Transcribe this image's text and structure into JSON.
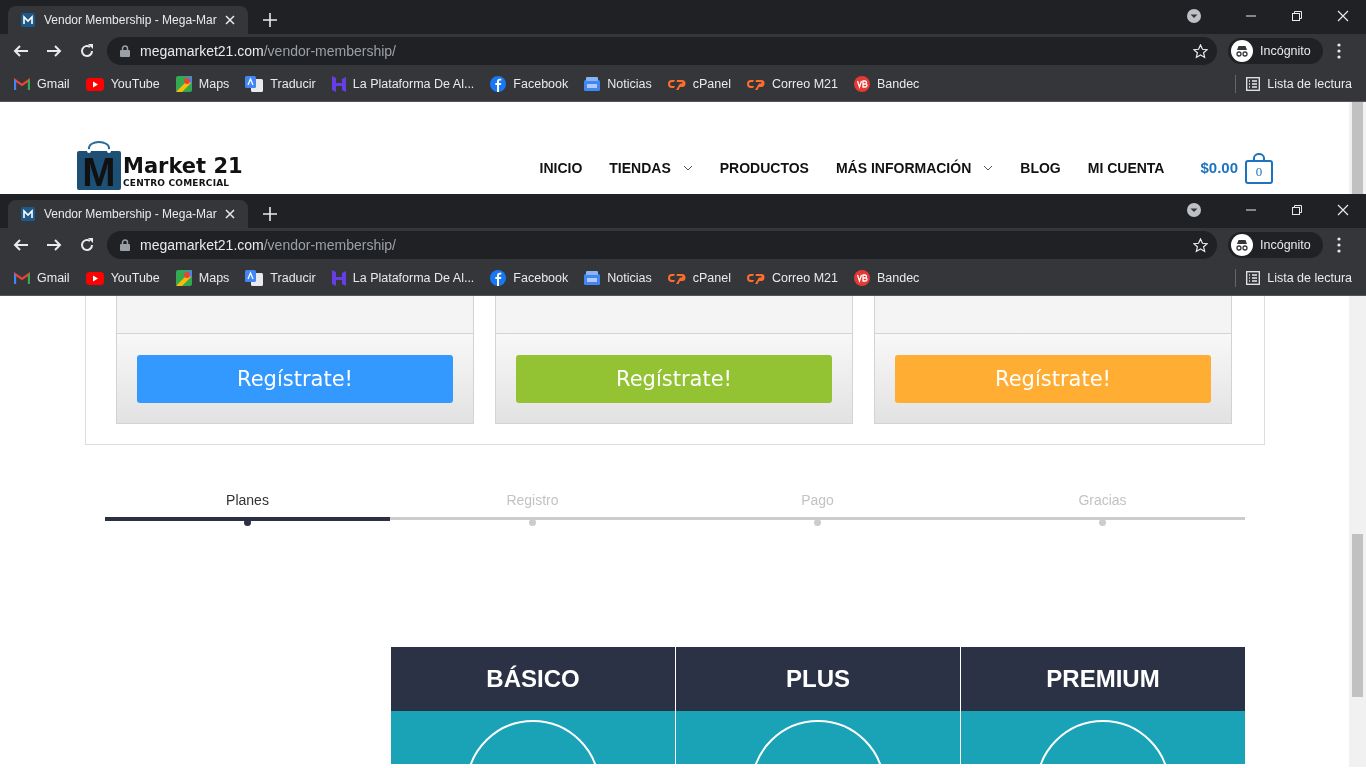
{
  "browser_windows": [
    {
      "tab_title": "Vendor Membership - Mega-Mar",
      "url_host": "megamarket21.com",
      "url_path": "/vendor-membership/",
      "profile": "Incógnito",
      "reading_list": "Lista de lectura",
      "bookmarks": [
        {
          "label": "Gmail",
          "kind": "gmail"
        },
        {
          "label": "YouTube",
          "kind": "youtube"
        },
        {
          "label": "Maps",
          "kind": "maps"
        },
        {
          "label": "Traducir",
          "kind": "translate"
        },
        {
          "label": "La Plataforma De Al...",
          "kind": "hostinger"
        },
        {
          "label": "Facebook",
          "kind": "facebook"
        },
        {
          "label": "Noticias",
          "kind": "news"
        },
        {
          "label": "cPanel",
          "kind": "cpanel"
        },
        {
          "label": "Correo M21",
          "kind": "cpanel"
        },
        {
          "label": "Bandec",
          "kind": "bandec"
        }
      ]
    },
    {
      "tab_title": "Vendor Membership - Mega-Mar",
      "url_host": "megamarket21.com",
      "url_path": "/vendor-membership/",
      "profile": "Incógnito",
      "reading_list": "Lista de lectura",
      "bookmarks": [
        {
          "label": "Gmail",
          "kind": "gmail"
        },
        {
          "label": "YouTube",
          "kind": "youtube"
        },
        {
          "label": "Maps",
          "kind": "maps"
        },
        {
          "label": "Traducir",
          "kind": "translate"
        },
        {
          "label": "La Plataforma De Al...",
          "kind": "hostinger"
        },
        {
          "label": "Facebook",
          "kind": "facebook"
        },
        {
          "label": "Noticias",
          "kind": "news"
        },
        {
          "label": "cPanel",
          "kind": "cpanel"
        },
        {
          "label": "Correo M21",
          "kind": "cpanel"
        },
        {
          "label": "Bandec",
          "kind": "bandec"
        }
      ]
    }
  ],
  "site_header": {
    "logo_letter": "M",
    "logo_title": "Market 21",
    "logo_subtitle": "CENTRO COMERCIAL",
    "cart_total": "$0.00",
    "cart_count": "0",
    "nav": [
      {
        "label": "INICIO",
        "dropdown": false
      },
      {
        "label": "TIENDAS",
        "dropdown": true
      },
      {
        "label": "PRODUCTOS",
        "dropdown": false
      },
      {
        "label": "MÁS INFORMACIÓN",
        "dropdown": true
      },
      {
        "label": "BLOG",
        "dropdown": false
      },
      {
        "label": "MI CUENTA",
        "dropdown": false
      }
    ]
  },
  "signup_buttons": [
    {
      "label": "Regístrate!",
      "color": "#3399ff"
    },
    {
      "label": "Regístrate!",
      "color": "#93c233"
    },
    {
      "label": "Regístrate!",
      "color": "#ffad33"
    }
  ],
  "steps": [
    {
      "label": "Planes",
      "selected": true
    },
    {
      "label": "Registro",
      "selected": false
    },
    {
      "label": "Pago",
      "selected": false
    },
    {
      "label": "Gracias",
      "selected": false
    }
  ],
  "plans": [
    {
      "name": "BÁSICO"
    },
    {
      "name": "PLUS"
    },
    {
      "name": "PREMIUM"
    }
  ]
}
